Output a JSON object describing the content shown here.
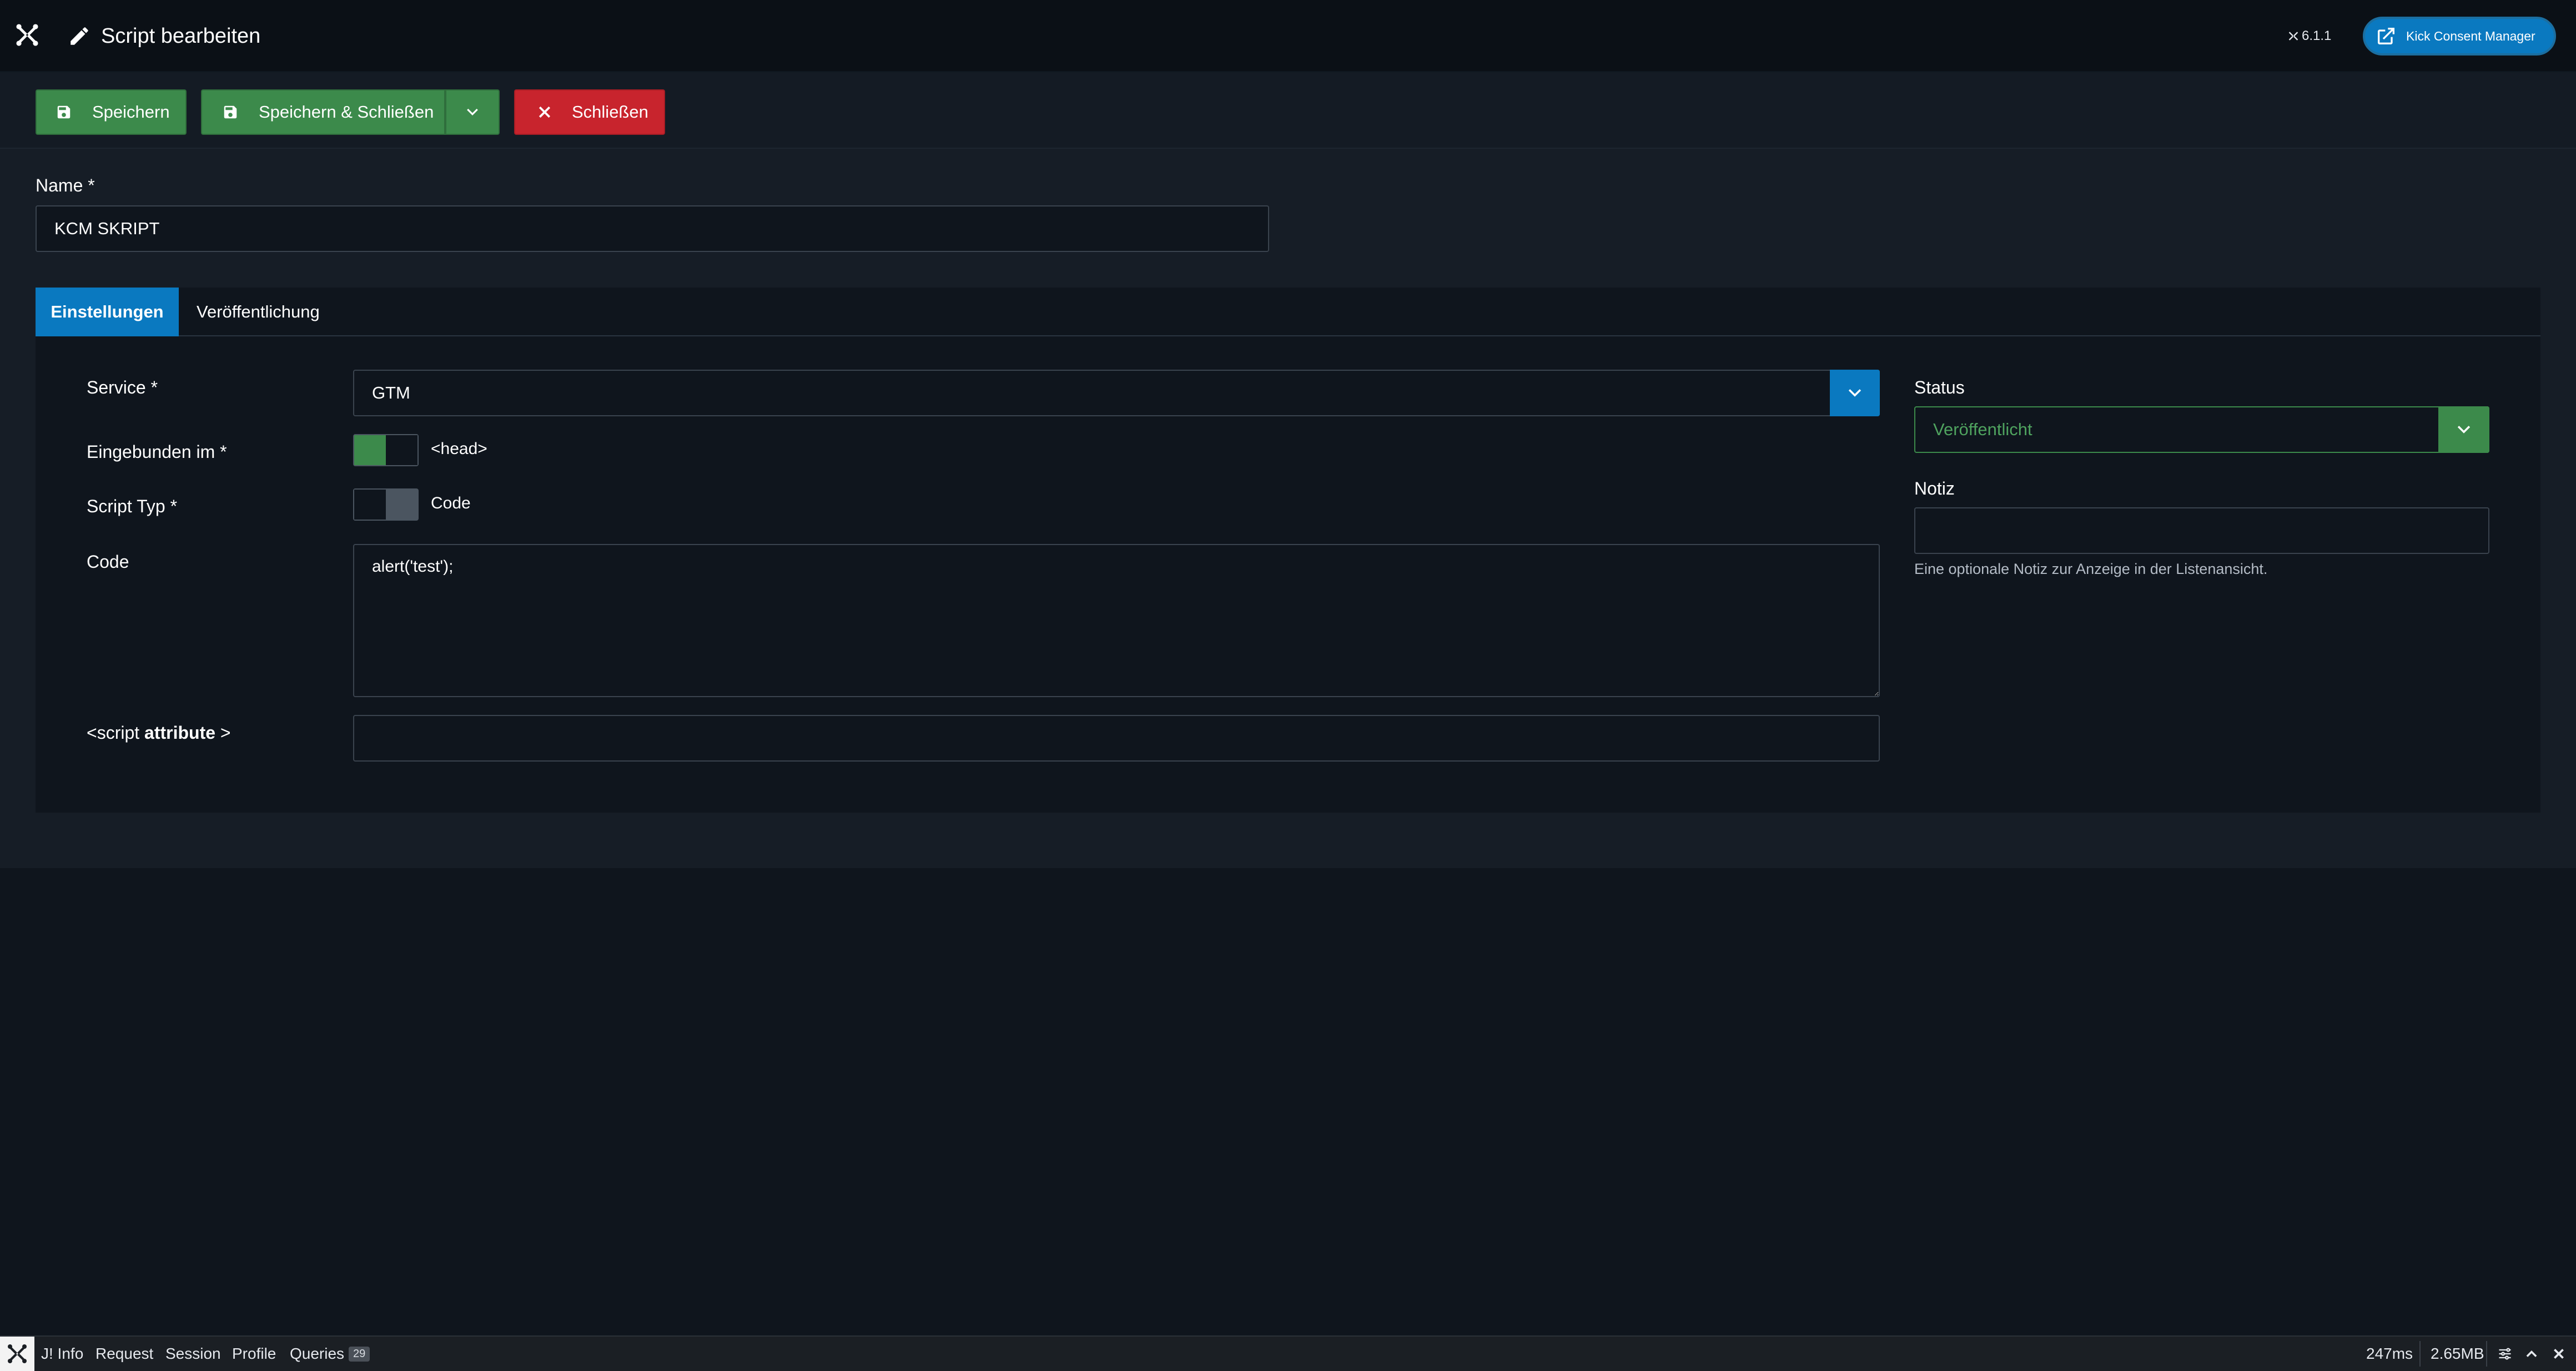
{
  "header": {
    "title": "Script bearbeiten",
    "version": "6.1.1",
    "site_button": "Kick Consent Manager"
  },
  "toolbar": {
    "save": "Speichern",
    "save_close": "Speichern & Schließen",
    "close": "Schließen"
  },
  "form": {
    "name_label": "Name *",
    "name_value": "KCM SKRIPT"
  },
  "tabs": [
    "Einstellungen",
    "Veröffentlichung"
  ],
  "settings": {
    "service_label": "Service *",
    "service_value": "GTM",
    "embedded_label": "Eingebunden im *",
    "embedded_value": "<head>",
    "script_type_label": "Script Typ *",
    "script_type_value": "Code",
    "code_label": "Code",
    "code_value": "alert('test');",
    "script_attr_prefix": "<script ",
    "script_attr_bold": "attribute",
    "script_attr_suffix": " >",
    "script_attr_value": ""
  },
  "sidebar": {
    "status_label": "Status",
    "status_value": "Veröffentlicht",
    "note_label": "Notiz",
    "note_value": "",
    "note_hint": "Eine optionale Notiz zur Anzeige in der Listenansicht."
  },
  "debugbar": {
    "items": [
      "J! Info",
      "Request",
      "Session",
      "Profile",
      "Queries"
    ],
    "queries_count": "29",
    "time": "247ms",
    "memory": "2.65MB"
  },
  "colors": {
    "primary": "#0a79c0",
    "success": "#3c8a4b",
    "danger": "#c8242d",
    "status_text": "#4fa35f"
  }
}
